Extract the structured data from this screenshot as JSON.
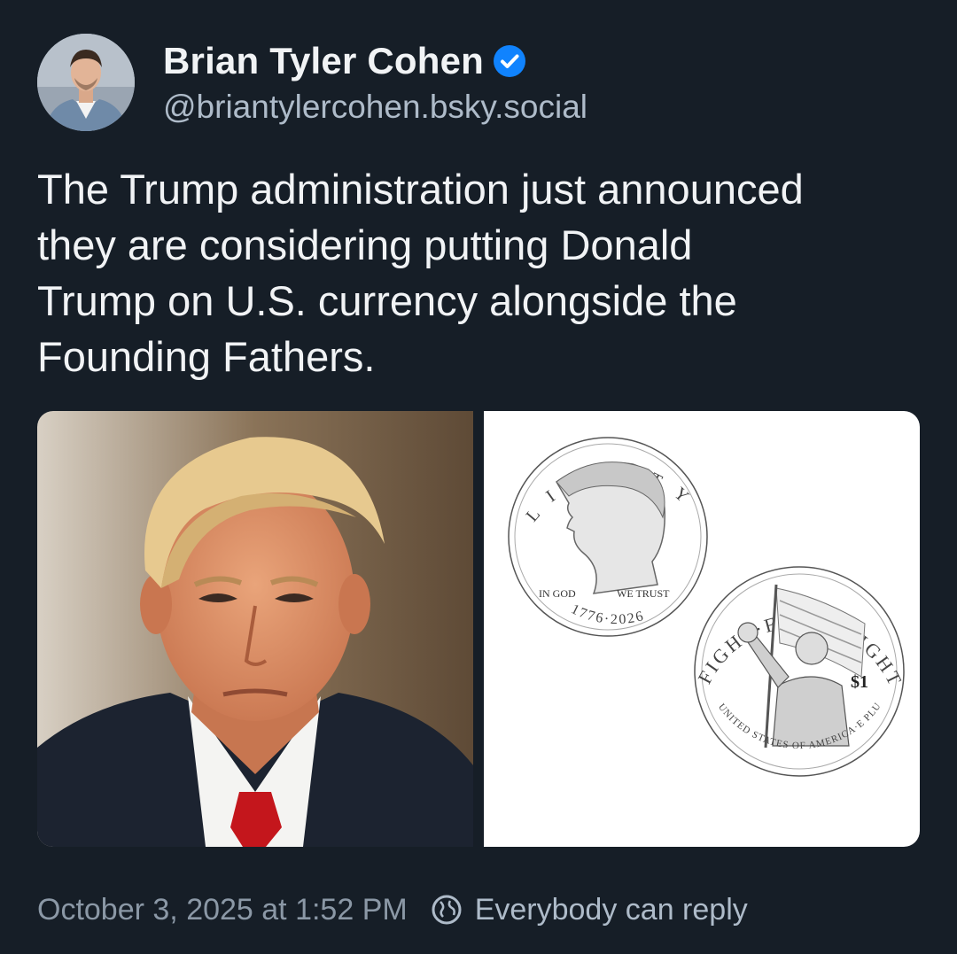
{
  "author": {
    "display_name": "Brian Tyler Cohen",
    "handle": "@briantylercohen.bsky.social",
    "verified": true,
    "verified_color": "#1083fe"
  },
  "post": {
    "text": "The Trump administration just announced\nthey are considering putting Donald\nTrump on U.S. currency alongside the\nFounding Fathers."
  },
  "coin": {
    "front_top": "LIBERTY",
    "front_left": "IN GOD",
    "front_right": "WE TRUST",
    "front_years": "1776·2026",
    "back_top": "FIGHT·FIGHT·FIGHT",
    "back_value": "$1",
    "back_bottom": "UNITED STATES OF AMERICA·E PLURIBUS UNUM"
  },
  "footer": {
    "timestamp": "October 3, 2025 at 1:52 PM",
    "reply_setting": "Everybody can reply"
  },
  "colors": {
    "background": "#161e27",
    "text_primary": "#f1f3f5",
    "text_secondary": "#aebbc9"
  }
}
